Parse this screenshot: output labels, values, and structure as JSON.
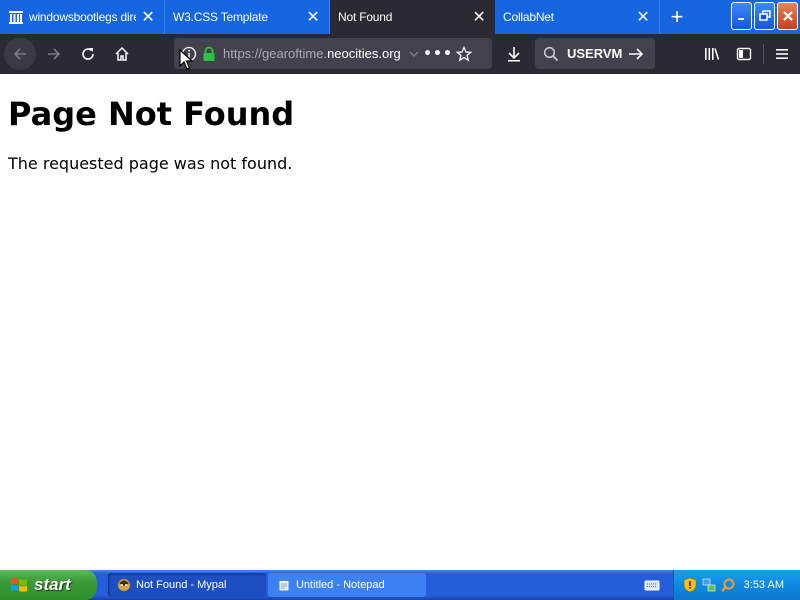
{
  "browser": {
    "tabs": [
      {
        "label": "windowsbootlegs dire",
        "icon": "archive-icon",
        "active": false
      },
      {
        "label": "W3.CSS Template",
        "icon": "none",
        "active": false
      },
      {
        "label": "Not Found",
        "icon": "none",
        "active": true
      },
      {
        "label": "CollabNet",
        "icon": "none",
        "active": false
      }
    ],
    "url": {
      "prefix": "https://gearoftime.",
      "domain": "neocities.org"
    },
    "search": {
      "value": "USERVM"
    }
  },
  "page": {
    "heading": "Page Not Found",
    "message": "The requested page was not found."
  },
  "taskbar": {
    "start_label": "start",
    "tasks": [
      {
        "label": "Not Found - Mypal",
        "icon": "mypal-icon",
        "active": true
      },
      {
        "label": "Untitled - Notepad",
        "icon": "notepad-icon",
        "active": false
      }
    ],
    "clock": "3:53 AM"
  },
  "colors": {
    "tab_strip": "#1566e0",
    "toolbar": "#2b2a33",
    "urlbar": "#42414d",
    "taskbar": "#245edb",
    "start_green": "#3a9a37",
    "tray": "#0e8ae0"
  }
}
